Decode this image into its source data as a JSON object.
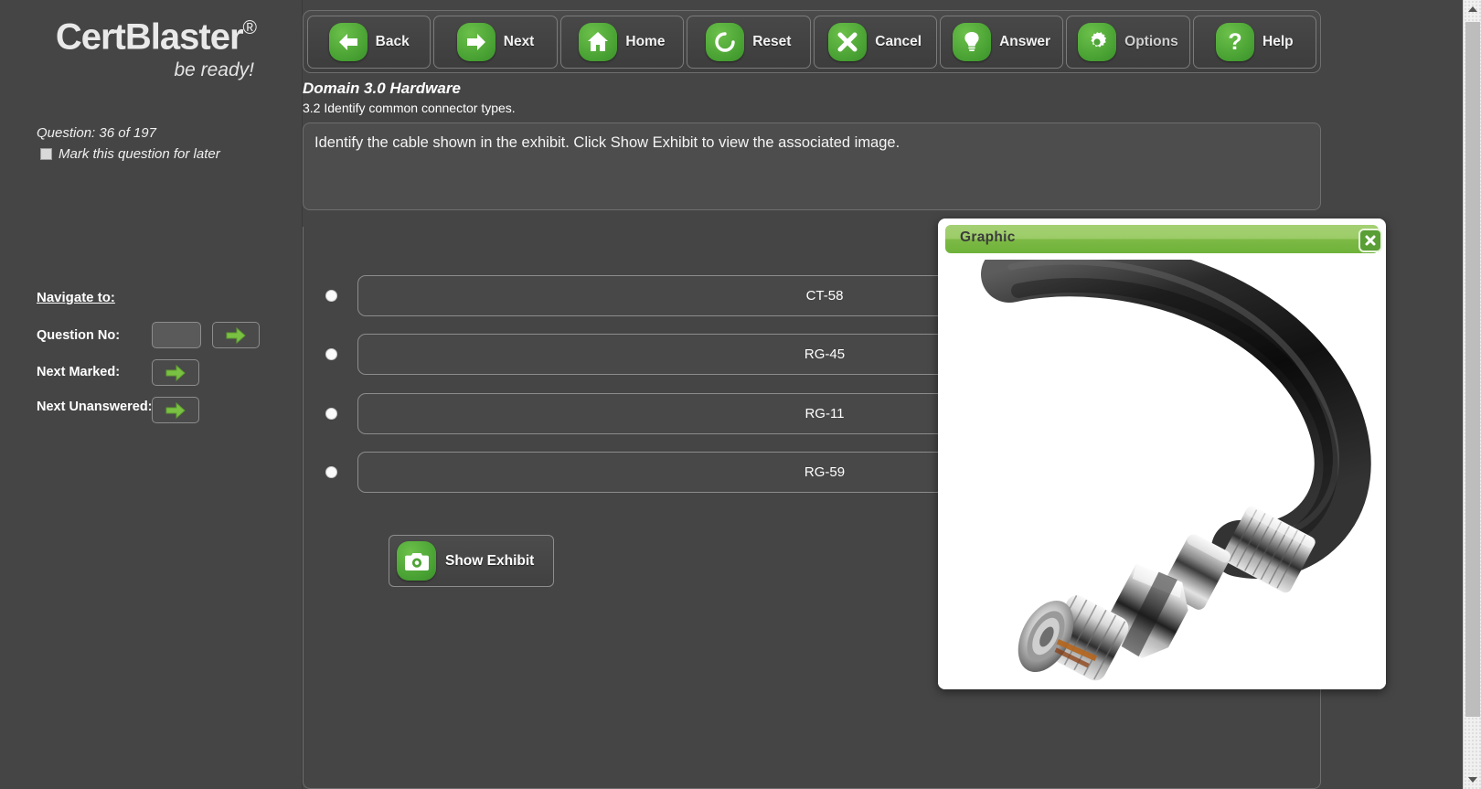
{
  "brand": {
    "name": "CertBlaster",
    "registered": "®",
    "tagline": "be ready!"
  },
  "sidebar": {
    "question_label": "Question:",
    "question_counter": "36 of 197",
    "mark_later_label": "Mark this question for later",
    "navigate_heading": "Navigate to:",
    "nav_rows": [
      {
        "label": "Question No:",
        "icon": "green-right-arrow-icon"
      },
      {
        "label": "Next Marked:",
        "icon": "green-right-arrow-icon"
      },
      {
        "label": "Next Unanswered:",
        "icon": "green-right-arrow-icon"
      }
    ],
    "question_no_value": "",
    "question_no_placeholder": ""
  },
  "toolbar": {
    "buttons": [
      {
        "label": "Back",
        "icon": "left-arrow-icon"
      },
      {
        "label": "Next",
        "icon": "right-arrow-icon"
      },
      {
        "label": "Home",
        "icon": "home-icon"
      },
      {
        "label": "Reset",
        "icon": "refresh-icon"
      },
      {
        "label": "Cancel",
        "icon": "x-icon"
      },
      {
        "label": "Answer",
        "icon": "lightbulb-icon"
      },
      {
        "label": "Options",
        "icon": "gear-icon"
      },
      {
        "label": "Help",
        "icon": "question-mark-icon"
      }
    ]
  },
  "content": {
    "domain_title": "Domain 3.0 Hardware",
    "objective": "3.2 Identify common connector types.",
    "question_text": "Identify the cable shown in the exhibit. Click Show Exhibit to view the associated image.",
    "options": [
      {
        "text": "CT-58",
        "selected": false
      },
      {
        "text": "RG-45",
        "selected": false
      },
      {
        "text": "RG-11",
        "selected": false
      },
      {
        "text": "RG-59",
        "selected": false
      }
    ],
    "show_exhibit_label": "Show Exhibit",
    "show_exhibit_icon": "camera-icon"
  },
  "graphic_window": {
    "title": "Graphic",
    "close_icon": "close-x-icon",
    "image_description": "Black coaxial cable curving from upper right down to a chrome F-type connector in the lower left, on a white background"
  },
  "colors": {
    "page_background": "#454545",
    "accent_green": "#47a032",
    "titlebar_green": "#9ccc68",
    "panel_header_gray": "#777777",
    "text_light": "#f2f2f2"
  },
  "scrollbar": {
    "up_icon": "triangle-up-icon",
    "down_icon": "triangle-down-icon"
  }
}
